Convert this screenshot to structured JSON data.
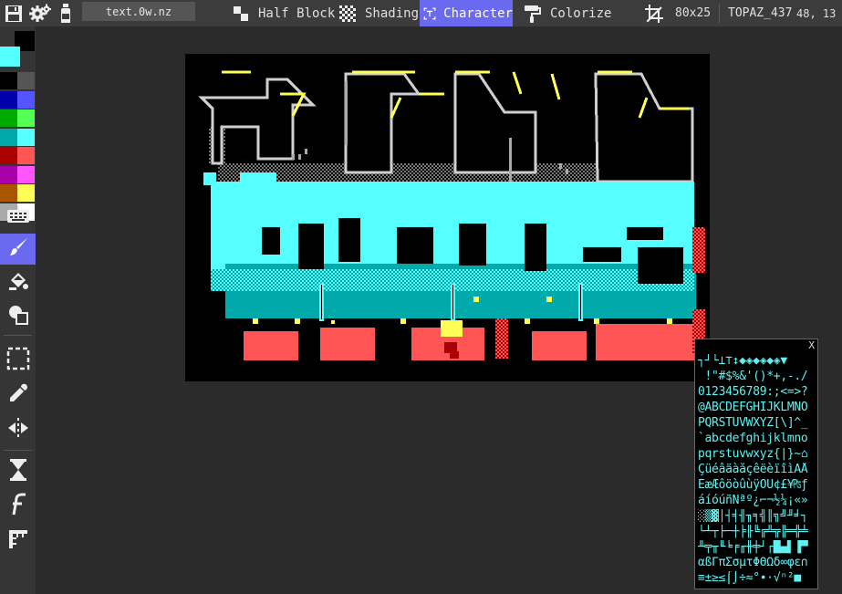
{
  "toolbar": {
    "filename": "text.0w.nz",
    "modes": [
      {
        "label": "Half Block"
      },
      {
        "label": "Shading"
      },
      {
        "label": "Character",
        "active": true
      },
      {
        "label": "Colorize"
      }
    ],
    "canvas_size": "80x25",
    "font": "TOPAZ_437",
    "cursor_pos": "48, 13"
  },
  "palette": {
    "foreground": "#000000",
    "background": "#55ffff",
    "colors": [
      [
        "#000000",
        "#555555"
      ],
      [
        "#0000aa",
        "#5555ff"
      ],
      [
        "#00aa00",
        "#55ff55"
      ],
      [
        "#00aaaa",
        "#55ffff"
      ],
      [
        "#aa0000",
        "#ff5555"
      ],
      [
        "#aa00aa",
        "#ff55ff"
      ],
      [
        "#aa5500",
        "#ffff55"
      ],
      [
        "#aaaaaa",
        "#ffffff"
      ]
    ]
  },
  "accent_color": "#6a6af0",
  "tools": [
    {
      "name": "keyboard-icon"
    },
    {
      "name": "brush-icon",
      "active": true
    },
    {
      "name": "fill-bucket-icon"
    },
    {
      "name": "shapes-icon"
    },
    {
      "name": "selection-icon"
    },
    {
      "name": "eyedropper-icon"
    },
    {
      "name": "mirror-icon"
    },
    {
      "name": "hourglass-icon"
    },
    {
      "name": "font-icon"
    },
    {
      "name": "ruler-icon"
    }
  ],
  "char_picker": {
    "close_label": "X",
    "rows": [
      "┐┘└⊥⊤↕◆◈◆◈◆◈▼",
      " !\"#$%&'()*+,-./",
      "0123456789:;<=>?",
      "@ABCDEFGHIJKLMNO",
      "PQRSTUVWXYZ[\\]^_",
      "`abcdefghijklmno",
      "pqrstuvwxyz{|}~⌂",
      "ÇüéâäàåçêëèïîìÄÅ",
      "ÉæÆôöòûùÿÖÜ¢£¥₧ƒ",
      "áíóúñÑªº¿⌐¬½¼¡«»",
      "░▒▓│┤╡╢╖╕╣║╗╝╜╛┐",
      "└┴┬├─┼╞╟╚╔╩╦╠═╬╧",
      "╨╤╥╙╘╒╓╫╪┘┌█▄▌▐▀",
      "αßΓπΣσµτΦΘΩδ∞φε∩",
      "≡±≥≤⌠⌡÷≈°∙·√ⁿ²■ "
    ]
  }
}
